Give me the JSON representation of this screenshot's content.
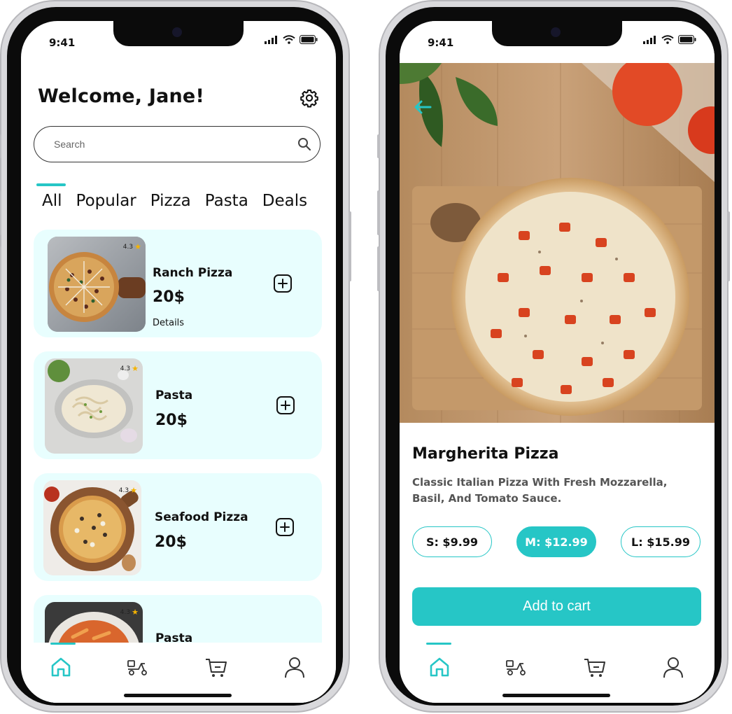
{
  "status": {
    "time": "9:41"
  },
  "home": {
    "welcome": "Welcome, Jane!",
    "search_placeholder": "Search",
    "tabs": [
      {
        "label": "All",
        "active": true
      },
      {
        "label": "Popular"
      },
      {
        "label": "Pizza"
      },
      {
        "label": "Pasta"
      },
      {
        "label": "Deals"
      }
    ],
    "items": [
      {
        "name": "Ranch Pizza",
        "price": "20$",
        "rating": "4.3",
        "details": "Details"
      },
      {
        "name": "Pasta",
        "price": "20$",
        "rating": "4.3"
      },
      {
        "name": "Seafood Pizza",
        "price": "20$",
        "rating": "4.3"
      },
      {
        "name": "Pasta",
        "price": "",
        "rating": "4.3"
      }
    ]
  },
  "detail": {
    "title": "Margherita Pizza",
    "description": "Classic Italian Pizza With Fresh Mozzarella, Basil, And Tomato Sauce.",
    "sizes": [
      {
        "label": "S: $9.99",
        "active": false
      },
      {
        "label": "M: $12.99",
        "active": true
      },
      {
        "label": "L: $15.99",
        "active": false
      }
    ],
    "cart_button": "Add to cart"
  },
  "nav": {
    "items": [
      "home-icon",
      "scooter-delivery-icon",
      "cart-icon",
      "user-icon"
    ],
    "active": "home-icon"
  },
  "colors": {
    "accent": "#26c6c6",
    "card_bg": "#e8fefe"
  }
}
